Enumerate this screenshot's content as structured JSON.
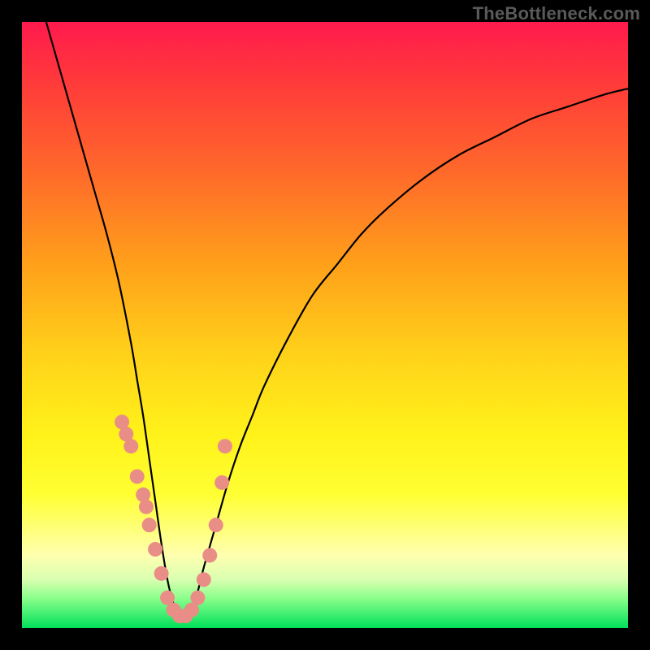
{
  "watermark": "TheBottleneck.com",
  "chart_data": {
    "type": "line",
    "title": "",
    "xlabel": "",
    "ylabel": "",
    "xlim": [
      0,
      100
    ],
    "ylim": [
      0,
      100
    ],
    "series": [
      {
        "name": "bottleneck-curve",
        "x": [
          4,
          6,
          8,
          10,
          12,
          14,
          16,
          18,
          19,
          20,
          21,
          22,
          23,
          24,
          25,
          26,
          27,
          28,
          29,
          30,
          32,
          34,
          36,
          38,
          40,
          44,
          48,
          52,
          56,
          60,
          66,
          72,
          78,
          84,
          90,
          96,
          100
        ],
        "values": [
          100,
          93,
          86,
          79,
          72,
          65,
          57,
          47,
          41,
          35,
          28,
          21,
          14,
          8,
          4,
          2,
          2,
          3,
          6,
          10,
          17,
          24,
          30,
          35,
          40,
          48,
          55,
          60,
          65,
          69,
          74,
          78,
          81,
          84,
          86,
          88,
          89
        ]
      }
    ],
    "markers": {
      "name": "highlighted-points",
      "color": "#e98d87",
      "radius_px": 9,
      "x": [
        16.5,
        17.2,
        18.0,
        19.0,
        20.0,
        20.5,
        21.0,
        22.0,
        23.0,
        24.0,
        25.0,
        26.0,
        27.0,
        28.0,
        29.0,
        30.0,
        31.0,
        32.0,
        33.0,
        33.5
      ],
      "values": [
        34.0,
        32.0,
        30.0,
        25.0,
        22.0,
        20.0,
        17.0,
        13.0,
        9.0,
        5.0,
        3.0,
        2.0,
        2.0,
        3.0,
        5.0,
        8.0,
        12.0,
        17.0,
        24.0,
        30.0
      ]
    }
  }
}
